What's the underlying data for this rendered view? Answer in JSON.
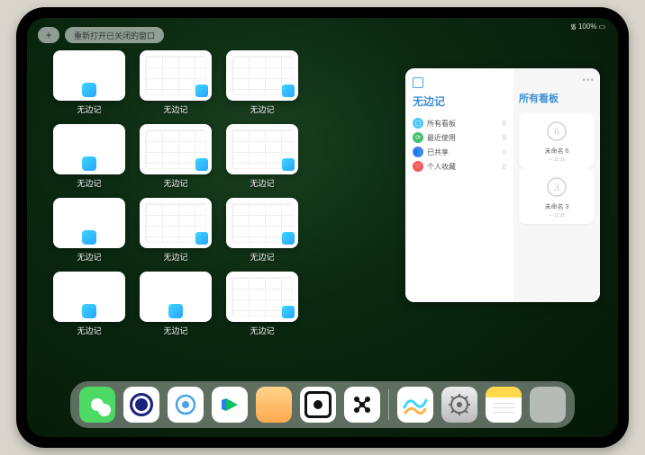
{
  "statusbar": {
    "wifi": "⋯",
    "battery": "100%"
  },
  "top": {
    "plus": "+",
    "reopen": "重新打开已关闭的窗口"
  },
  "tiles": [
    {
      "kind": "blank",
      "label": "无边记"
    },
    {
      "kind": "grid",
      "label": "无边记"
    },
    {
      "kind": "grid",
      "label": "无边记"
    },
    {
      "kind": "empty",
      "label": ""
    },
    {
      "kind": "blank",
      "label": "无边记"
    },
    {
      "kind": "grid",
      "label": "无边记"
    },
    {
      "kind": "grid",
      "label": "无边记"
    },
    {
      "kind": "empty",
      "label": ""
    },
    {
      "kind": "blank",
      "label": "无边记"
    },
    {
      "kind": "grid",
      "label": "无边记"
    },
    {
      "kind": "grid",
      "label": "无边记"
    },
    {
      "kind": "empty",
      "label": ""
    },
    {
      "kind": "blank",
      "label": "无边记"
    },
    {
      "kind": "blank",
      "label": "无边记"
    },
    {
      "kind": "grid",
      "label": "无边记"
    },
    {
      "kind": "empty",
      "label": ""
    }
  ],
  "panel": {
    "title": "无边记",
    "items": [
      {
        "icon_color": "#4cc7f5",
        "glyph": "▢",
        "label": "所有看板",
        "count": 8
      },
      {
        "icon_color": "#44c06e",
        "glyph": "⟳",
        "label": "最近使用",
        "count": 8
      },
      {
        "icon_color": "#4a7cf0",
        "glyph": "👥",
        "label": "已共享",
        "count": 0
      },
      {
        "icon_color": "#f25a5a",
        "glyph": "♡",
        "label": "个人收藏",
        "count": 0
      }
    ],
    "right_title": "所有看板",
    "boards": [
      {
        "name": "未命名 6",
        "sub": "— 11:26",
        "digit": "6"
      },
      {
        "name": "未命名 3",
        "sub": "— 11:25",
        "digit": "3"
      }
    ]
  },
  "dock": [
    {
      "name": "wechat-icon"
    },
    {
      "name": "quark-icon"
    },
    {
      "name": "quark-hd-icon"
    },
    {
      "name": "iqiyi-icon"
    },
    {
      "name": "books-icon"
    },
    {
      "name": "procreate-icon"
    },
    {
      "name": "molecule-app-icon"
    },
    {
      "name": "freeform-icon"
    },
    {
      "name": "settings-icon"
    },
    {
      "name": "notes-icon"
    },
    {
      "name": "app-folder-icon"
    }
  ]
}
